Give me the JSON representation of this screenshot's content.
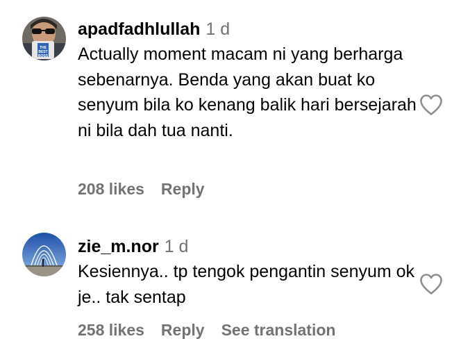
{
  "comments": [
    {
      "username": "apadfadhlullah",
      "time": "1 d",
      "text": "Actually moment macam ni yang berharga sebenarnya. Benda yang akan buat ko senyum bila ko kenang balik hari bersejarah ni bila dah tua nanti.",
      "likes": "208 likes",
      "reply_label": "Reply",
      "avatar_mug_text": "THE BEST BOSS",
      "like_icon": "heart-outline-icon"
    },
    {
      "username": "zie_m.nor",
      "time": "1 d",
      "text": "Kesiennya.. tp tengok pengantin senyum ok je.. tak sentap",
      "likes": "258 likes",
      "reply_label": "Reply",
      "translation_label": "See translation",
      "like_icon": "heart-outline-icon"
    }
  ],
  "colors": {
    "primary_text": "#000000",
    "secondary_text": "#737373",
    "icon_stroke": "#8e8e8e"
  }
}
